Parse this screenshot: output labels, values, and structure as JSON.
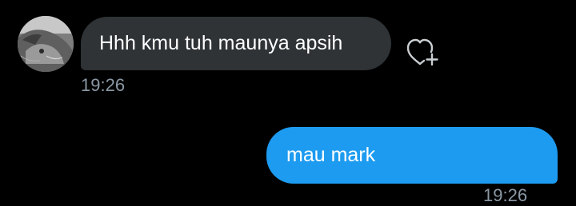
{
  "messages": {
    "incoming": {
      "text": "Hhh kmu tuh maunya apsih",
      "time": "19:26",
      "reaction_icon": "heart-plus-icon",
      "avatar_icon": "cat-photo-avatar"
    },
    "outgoing": {
      "text": "mau mark",
      "time": "19:26"
    }
  },
  "colors": {
    "background": "#000000",
    "incoming_bubble": "#2f3336",
    "outgoing_bubble": "#1d9bf0",
    "timestamp": "#8b98a5",
    "text": "#ffffff"
  }
}
